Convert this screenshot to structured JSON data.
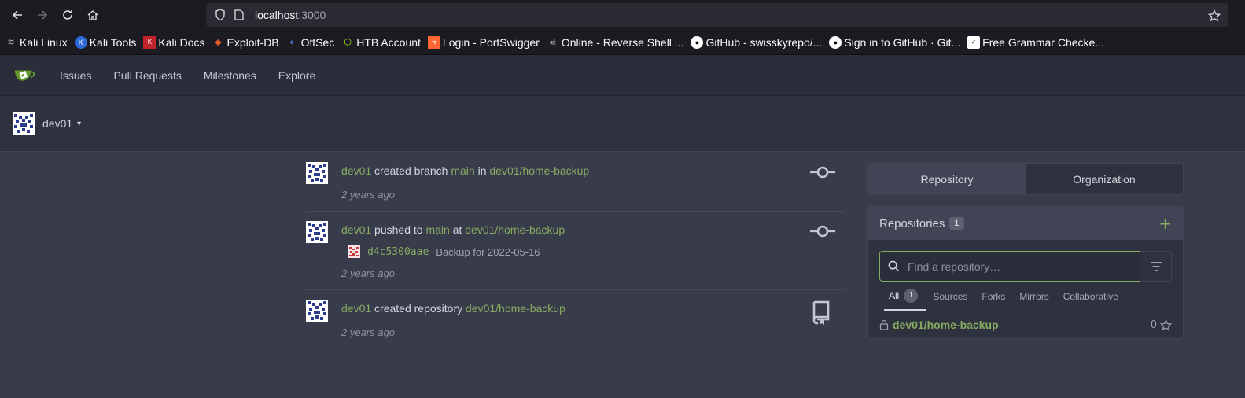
{
  "browser": {
    "url_host": "localhost",
    "url_port": ":3000",
    "bookmarks": [
      {
        "label": "Kali Linux",
        "icon": "kali-dragon-icon"
      },
      {
        "label": "Kali Tools",
        "icon": "kali-tools-icon"
      },
      {
        "label": "Kali Docs",
        "icon": "kali-docs-icon"
      },
      {
        "label": "Exploit-DB",
        "icon": "exploit-db-icon"
      },
      {
        "label": "OffSec",
        "icon": "offsec-icon"
      },
      {
        "label": "HTB Account",
        "icon": "htb-cube-icon"
      },
      {
        "label": "Login - PortSwigger",
        "icon": "portswigger-icon"
      },
      {
        "label": "Online - Reverse Shell ...",
        "icon": "skull-icon"
      },
      {
        "label": "GitHub - swisskyrepo/...",
        "icon": "github-icon"
      },
      {
        "label": "Sign in to GitHub · Git...",
        "icon": "github-icon"
      },
      {
        "label": "Free Grammar Checke...",
        "icon": "grammar-icon"
      }
    ]
  },
  "nav": {
    "items": [
      "Issues",
      "Pull Requests",
      "Milestones",
      "Explore"
    ]
  },
  "context": {
    "user": "dev01"
  },
  "feed": [
    {
      "user": "dev01",
      "action": "created branch",
      "ref": "main",
      "prep": "in",
      "repo": "dev01/home-backup",
      "time": "2 years ago",
      "icon": "git-commit-icon"
    },
    {
      "user": "dev01",
      "action": "pushed to",
      "ref": "main",
      "prep": "at",
      "repo": "dev01/home-backup",
      "commit_sha": "d4c5300aae",
      "commit_msg": "Backup for 2022-05-16",
      "time": "2 years ago",
      "icon": "git-commit-icon"
    },
    {
      "user": "dev01",
      "action": "created repository",
      "repo": "dev01/home-backup",
      "time": "2 years ago",
      "icon": "repo-icon"
    }
  ],
  "side": {
    "tab_repository": "Repository",
    "tab_organization": "Organization",
    "repos_title": "Repositories",
    "repos_count": "1",
    "search_placeholder": "Find a repository…",
    "filter_tabs": {
      "all": "All",
      "all_count": "1",
      "sources": "Sources",
      "forks": "Forks",
      "mirrors": "Mirrors",
      "collaborative": "Collaborative"
    },
    "repo": {
      "name": "dev01/home-backup",
      "stars": "0"
    }
  },
  "colors": {
    "link_green": "#87ab63",
    "page_bg": "#383c4a"
  }
}
